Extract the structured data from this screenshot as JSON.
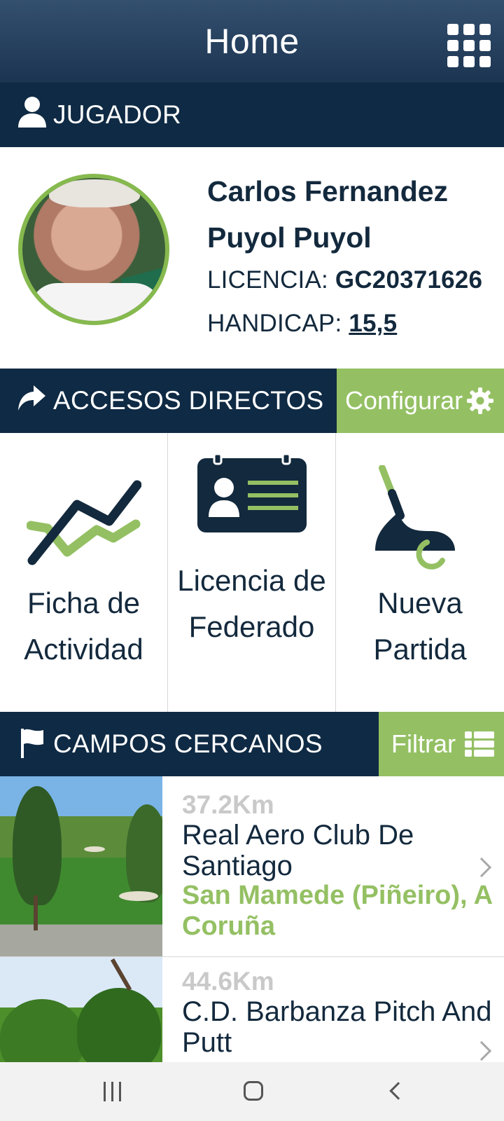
{
  "header": {
    "title": "Home",
    "menu_icon": "apps-grid-icon"
  },
  "player_section": {
    "label": "JUGADOR",
    "icon": "person-icon"
  },
  "player": {
    "name": "Carlos Fernandez Puyol Puyol",
    "license_label": "LICENCIA:",
    "license_value": "GC20371626",
    "handicap_label": "HANDICAP:",
    "handicap_value": "15,5"
  },
  "shortcuts_section": {
    "label": "ACCESOS DIRECTOS",
    "icon": "share-arrow-icon",
    "configure_label": "Configurar",
    "configure_icon": "gear-icon"
  },
  "shortcuts": [
    {
      "label": "Ficha de Actividad",
      "icon": "activity-chart-icon"
    },
    {
      "label": "Licencia de Federado",
      "icon": "id-card-icon"
    },
    {
      "label": "Nueva Partida",
      "icon": "golf-putter-icon"
    }
  ],
  "courses_section": {
    "label": "CAMPOS CERCANOS",
    "icon": "flag-icon",
    "filter_label": "Filtrar",
    "filter_icon": "list-icon"
  },
  "courses": [
    {
      "distance": "37.2Km",
      "name": "Real Aero Club De Santiago",
      "location": "San Mamede (Piñeiro), A Coruña"
    },
    {
      "distance": "44.6Km",
      "name": "C.D. Barbanza Pitch And Putt",
      "location": ""
    }
  ],
  "colors": {
    "navy": "#0f2a44",
    "header": "#1b3451",
    "accent_green": "#94c063",
    "text": "#13293d"
  }
}
